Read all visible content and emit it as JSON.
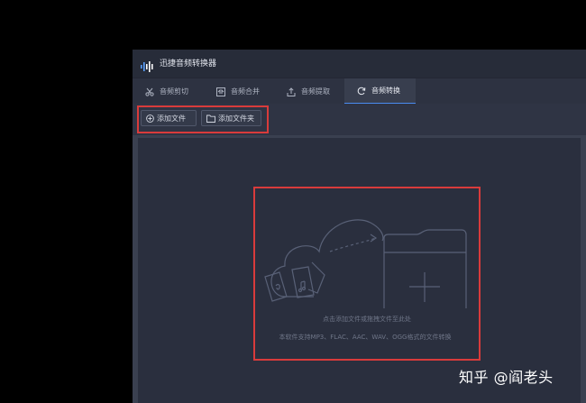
{
  "app": {
    "title": "迅捷音频转换器"
  },
  "tabs": [
    {
      "label": "音频剪切",
      "icon": "scissors-icon",
      "active": false
    },
    {
      "label": "音频合并",
      "icon": "merge-icon",
      "active": false
    },
    {
      "label": "音频提取",
      "icon": "upload-icon",
      "active": false
    },
    {
      "label": "音频转换",
      "icon": "refresh-icon",
      "active": true
    }
  ],
  "toolbar": {
    "add_file_label": "添加文件",
    "add_folder_label": "添加文件夹"
  },
  "dropzone": {
    "hint": "点击添加文件或拖拽文件至此处",
    "formats": "本软件支持MP3、FLAC、AAC、WAV、OGG格式的文件转换"
  },
  "watermark": "知乎 @阎老头",
  "colors": {
    "accent": "#4a8bf0",
    "highlight_box": "#d93b3b",
    "background": "#2a2f3d"
  }
}
